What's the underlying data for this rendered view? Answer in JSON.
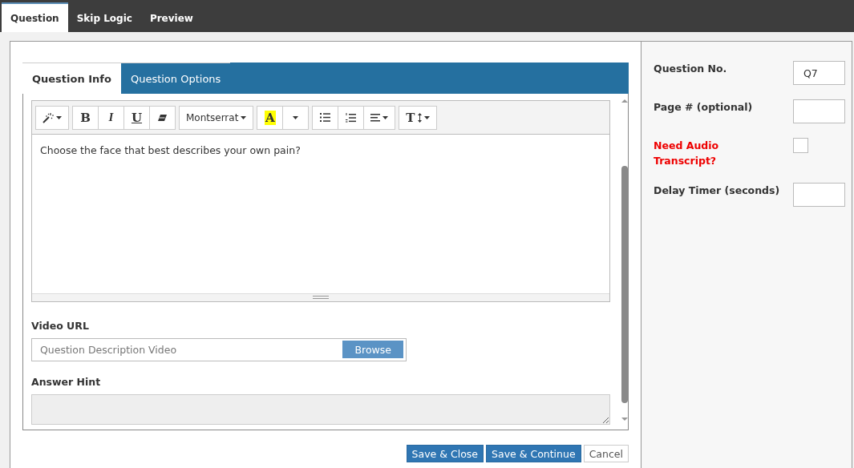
{
  "top_tabs": [
    {
      "label": "Question",
      "selected": true
    },
    {
      "label": "Skip Logic",
      "selected": false
    },
    {
      "label": "Preview",
      "selected": false
    }
  ],
  "inner_tabs": [
    {
      "label": "Question Info",
      "selected": true
    },
    {
      "label": "Question Options",
      "selected": false
    }
  ],
  "toolbar": [
    [
      {
        "kind": "magic"
      }
    ],
    [
      {
        "kind": "bold",
        "label": "B"
      },
      {
        "kind": "italic",
        "label": "I"
      },
      {
        "kind": "underline",
        "label": "U"
      },
      {
        "kind": "eraser"
      }
    ],
    [
      {
        "kind": "font",
        "label": "Montserrat"
      }
    ],
    [
      {
        "kind": "highlight",
        "label": "A"
      },
      {
        "kind": "caret"
      }
    ],
    [
      {
        "kind": "bullets"
      },
      {
        "kind": "numbers"
      },
      {
        "kind": "align"
      }
    ],
    [
      {
        "kind": "textsize",
        "label": "T"
      }
    ]
  ],
  "editor": {
    "text": "Choose the face that best describes your own pain?"
  },
  "video_url": {
    "label": "Video URL",
    "placeholder": "Question Description Video",
    "browse": "Browse"
  },
  "answer_hint": {
    "label": "Answer Hint"
  },
  "buttons": [
    {
      "label": "Save & Close",
      "kind": "primary"
    },
    {
      "label": "Save & Continue",
      "kind": "primary"
    },
    {
      "label": "Cancel",
      "kind": "default"
    }
  ],
  "side_fields": [
    {
      "kind": "input",
      "label": "Question No.",
      "value": "Q7",
      "emphasis": false
    },
    {
      "kind": "input",
      "label": "Page # (optional)",
      "emphasis": false
    },
    {
      "kind": "checkbox",
      "label": "Need Audio Transcript?",
      "checked": false,
      "emphasis": true
    },
    {
      "kind": "input",
      "label": "Delay Timer (seconds)",
      "emphasis": false
    }
  ]
}
